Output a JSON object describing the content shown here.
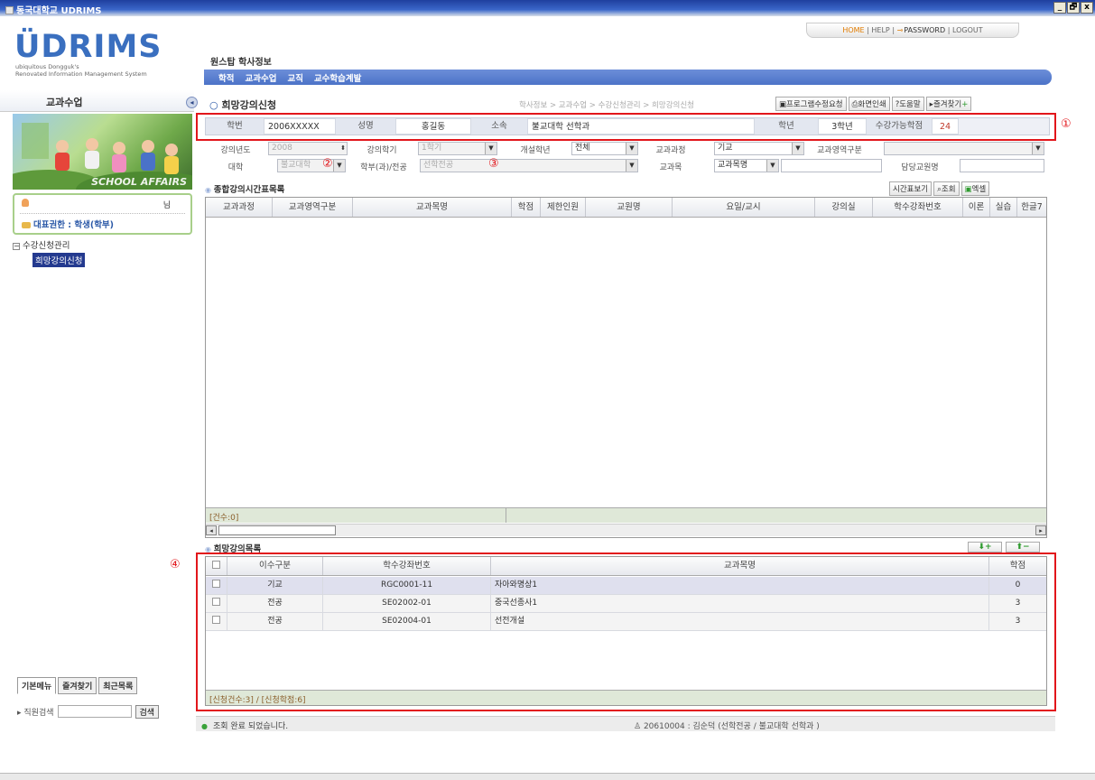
{
  "window": {
    "title": "동국대학교 UDRIMS",
    "controls": [
      "_",
      "🗗",
      "x"
    ]
  },
  "brand": {
    "logo": "ÜDRIMS",
    "sub_line1": "ubiquitous Dongguk's",
    "sub_line2": "Renovated Information Management System"
  },
  "toplinks": {
    "home": "HOME",
    "help": "HELP",
    "password": "PASSWORD",
    "logout": "LOGOUT",
    "sep": "|"
  },
  "system_path": "원스탑  학사정보",
  "menubar": [
    "학적",
    "교과수업",
    "교직",
    "교수학습계발"
  ],
  "left": {
    "title": "교과수업",
    "banner_caption": "SCHOOL AFFAIRS",
    "user_suffix": "님",
    "role": "대표권한 : 학생(학부)",
    "tree_root": "수강신청관리",
    "tree_child": "희망강의신청",
    "tabs": [
      "기본메뉴",
      "즐겨찾기",
      "최근목록"
    ],
    "search_label": "▸ 직원검색",
    "search_button": "검색"
  },
  "page": {
    "title": "희망강의신청",
    "breadcrumb": "학사정보 > 교과수업 > 수강신청관리 > 희망강의신청",
    "buttons": [
      "프로그램수정요청",
      "화면인쇄",
      "도움말",
      "즐겨찾기"
    ]
  },
  "info": {
    "student_no_label": "학번",
    "student_no": "2006XXXXX",
    "name_label": "성명",
    "name": "홍길동",
    "dept_label": "소속",
    "dept": "불교대학 선학과",
    "year_label": "학년",
    "year": "3학년",
    "credit_label": "수강가능학점",
    "credit": "24"
  },
  "form": {
    "lecture_year_label": "강의년도",
    "lecture_year": "2008",
    "semester_label": "강의학기",
    "semester": "1학기",
    "open_grade_label": "개설학년",
    "open_grade": "전체",
    "course_type_label": "교과과정",
    "course_type": "기교",
    "area_label": "교과영역구분",
    "area": "",
    "college_label": "대학",
    "college": "불교대학",
    "major_label": "학부(과)/전공",
    "major": "선학전공",
    "subject_label": "교과목",
    "subject_select": "교과목명",
    "subject_value": "",
    "prof_label": "담당교원명",
    "prof_value": ""
  },
  "annotations": [
    "①",
    "②",
    "③",
    "④"
  ],
  "timetable": {
    "title": "종합강의시간표목록",
    "buttons": [
      "시간표보기",
      "조회",
      "엑셀"
    ],
    "columns": [
      "교과과정",
      "교과영역구분",
      "교과목명",
      "학점",
      "제한인원",
      "교원명",
      "요일/교시",
      "강의실",
      "학수강좌번호",
      "이론",
      "실습",
      "한글7"
    ],
    "count": "[건수:0]"
  },
  "wishlist": {
    "title": "희망강의목록",
    "add_button": "+",
    "remove_button": "−",
    "columns": [
      "이수구분",
      "학수강좌번호",
      "교과목명",
      "학점"
    ],
    "rows": [
      {
        "type": "기교",
        "code": "RGC0001-11",
        "name": "자아와명상1",
        "credit": "0"
      },
      {
        "type": "전공",
        "code": "SE02002-01",
        "name": "중국선종사1",
        "credit": "3"
      },
      {
        "type": "전공",
        "code": "SE02004-01",
        "name": "선전개설",
        "credit": "3"
      }
    ],
    "summary": "[신청건수:3] / [신청학점:6]"
  },
  "status": {
    "message": "조회 완료 되었습니다.",
    "user": "20610004 : 김순덕 (선학전공 / 불교대학 선학과 )"
  },
  "colors": {
    "highlight_box": "#e2161b",
    "menubar": "#4c73c8",
    "selected_row": "#dfe0ee"
  }
}
